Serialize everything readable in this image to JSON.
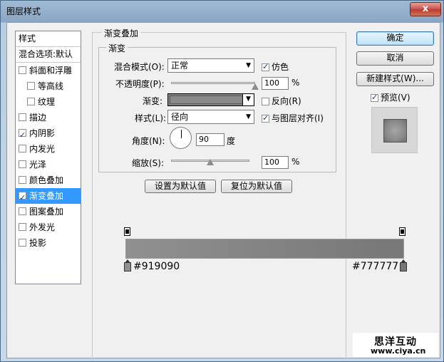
{
  "window": {
    "title": "图层样式",
    "close_label": "x"
  },
  "style_list": {
    "header": "样式",
    "blend_options": "混合选项:默认",
    "items": [
      {
        "label": "斜面和浮雕",
        "checked": false
      },
      {
        "label": "等高线",
        "checked": false
      },
      {
        "label": "纹理",
        "checked": false
      },
      {
        "label": "描边",
        "checked": false
      },
      {
        "label": "内阴影",
        "checked": true
      },
      {
        "label": "内发光",
        "checked": false
      },
      {
        "label": "光泽",
        "checked": false
      },
      {
        "label": "颜色叠加",
        "checked": false
      },
      {
        "label": "渐变叠加",
        "checked": true
      },
      {
        "label": "图案叠加",
        "checked": false
      },
      {
        "label": "外发光",
        "checked": false
      },
      {
        "label": "投影",
        "checked": false
      }
    ]
  },
  "panel": {
    "outer_legend": "渐变叠加",
    "inner_legend": "渐变",
    "blend_mode_label": "混合模式(O):",
    "blend_mode_value": "正常",
    "dither_label": "仿色",
    "dither_checked": true,
    "opacity_label": "不透明度(P):",
    "opacity_value": "100",
    "opacity_unit": "%",
    "opacity_level": 1.0,
    "gradient_label": "渐变:",
    "reverse_label": "反向(R)",
    "reverse_checked": false,
    "style_label": "样式(L):",
    "style_value": "径向",
    "align_label": "与图层对齐(I)",
    "align_checked": true,
    "angle_label": "角度(N):",
    "angle_value": "90",
    "angle_unit": "度",
    "scale_label": "缩放(S):",
    "scale_value": "100",
    "scale_unit": "%",
    "scale_level": 0.5,
    "set_default_button": "设置为默认值",
    "reset_default_button": "复位为默认值"
  },
  "buttons": {
    "ok": "确定",
    "cancel": "取消",
    "new_style": "新建样式(W)...",
    "preview_label": "预览(V)",
    "preview_checked": true
  },
  "gradient_editor": {
    "start_color": "#919090",
    "end_color": "#777777",
    "start_label": "#919090",
    "end_label": "#777777"
  },
  "watermark": {
    "title": "思洋互动",
    "url": "www.ciya.cn"
  }
}
